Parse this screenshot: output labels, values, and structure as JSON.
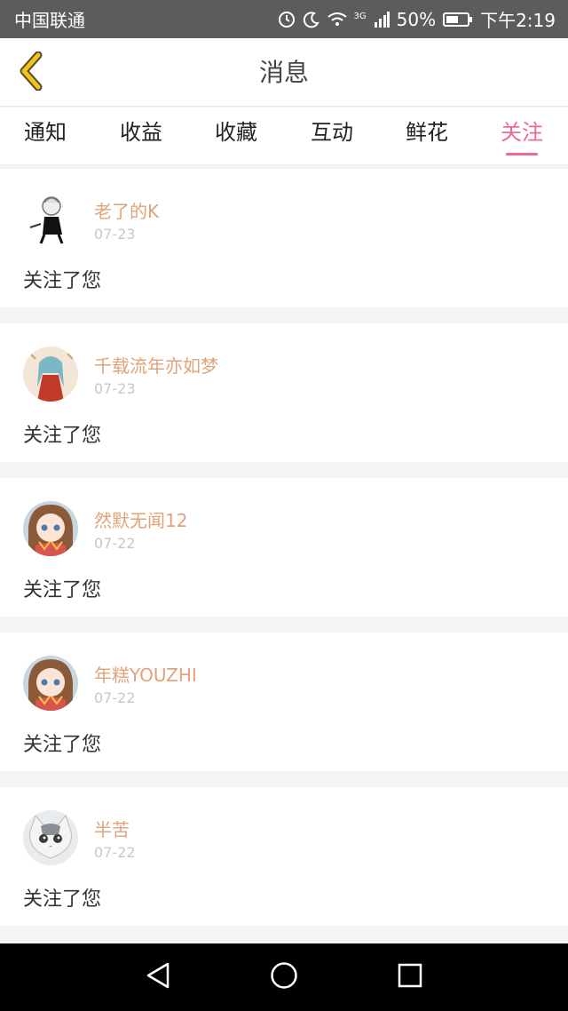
{
  "status_bar": {
    "carrier": "中国联通",
    "network": "3G",
    "battery": "50%",
    "time": "下午2:19"
  },
  "header": {
    "title": "消息",
    "back_icon": "chevron-left-icon"
  },
  "tabs": [
    {
      "label": "通知",
      "active": false
    },
    {
      "label": "收益",
      "active": false
    },
    {
      "label": "收藏",
      "active": false
    },
    {
      "label": "互动",
      "active": false
    },
    {
      "label": "鲜花",
      "active": false
    },
    {
      "label": "关注",
      "active": true
    }
  ],
  "items": [
    {
      "name": "老了的K",
      "date": "07-23",
      "message": "关注了您"
    },
    {
      "name": "千载流年亦如梦",
      "date": "07-23",
      "message": "关注了您"
    },
    {
      "name": "然默无闻12",
      "date": "07-22",
      "message": "关注了您"
    },
    {
      "name": "年糕YOUZHI",
      "date": "07-22",
      "message": "关注了您"
    },
    {
      "name": "半苦",
      "date": "07-22",
      "message": "关注了您"
    }
  ],
  "colors": {
    "accent": "#e86a9b",
    "username": "#e0a37a",
    "back_icon": "#f0c419"
  }
}
